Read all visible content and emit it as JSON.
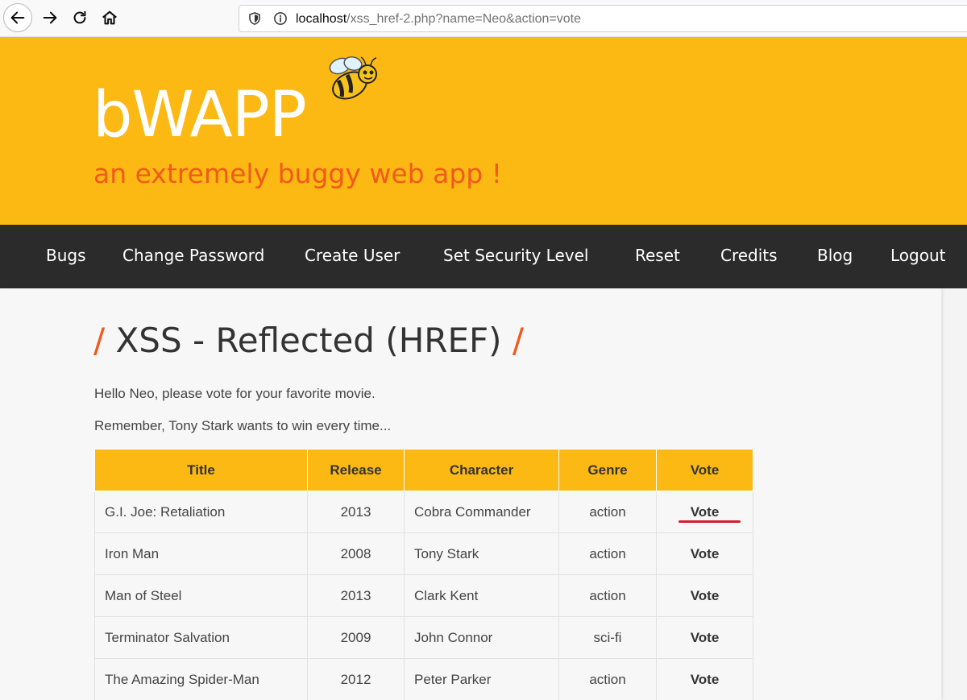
{
  "browser": {
    "url_host": "localhost",
    "url_path": "/xss_href-2.php?name=Neo&action=vote"
  },
  "header": {
    "logo": "bWAPP",
    "tagline": "an extremely buggy web app !"
  },
  "menu": {
    "items": [
      "Bugs",
      "Change Password",
      "Create User",
      "Set Security Level",
      "Reset",
      "Credits",
      "Blog",
      "Logout"
    ]
  },
  "page": {
    "title": "XSS - Reflected (HREF)",
    "slash": "/",
    "greeting": "Hello Neo, please vote for your favorite movie.",
    "note": "Remember, Tony Stark wants to win every time..."
  },
  "table": {
    "headers": [
      "Title",
      "Release",
      "Character",
      "Genre",
      "Vote"
    ],
    "rows": [
      {
        "title": "G.I. Joe: Retaliation",
        "release": "2013",
        "character": "Cobra Commander",
        "genre": "action",
        "vote": "Vote"
      },
      {
        "title": "Iron Man",
        "release": "2008",
        "character": "Tony Stark",
        "genre": "action",
        "vote": "Vote"
      },
      {
        "title": "Man of Steel",
        "release": "2013",
        "character": "Clark Kent",
        "genre": "action",
        "vote": "Vote"
      },
      {
        "title": "Terminator Salvation",
        "release": "2009",
        "character": "John Connor",
        "genre": "sci-fi",
        "vote": "Vote"
      },
      {
        "title": "The Amazing Spider-Man",
        "release": "2012",
        "character": "Peter Parker",
        "genre": "action",
        "vote": "Vote"
      }
    ]
  },
  "colors": {
    "header_bg": "#fdb913",
    "menu_bg": "#2b2b2b",
    "accent": "#f05a1a",
    "annotation": "#d8192f"
  },
  "icons": {
    "back": "back-arrow-icon",
    "forward": "forward-arrow-icon",
    "reload": "reload-icon",
    "home": "home-icon",
    "shield": "shield-icon",
    "info": "info-icon",
    "logo_mascot": "bee-icon"
  }
}
